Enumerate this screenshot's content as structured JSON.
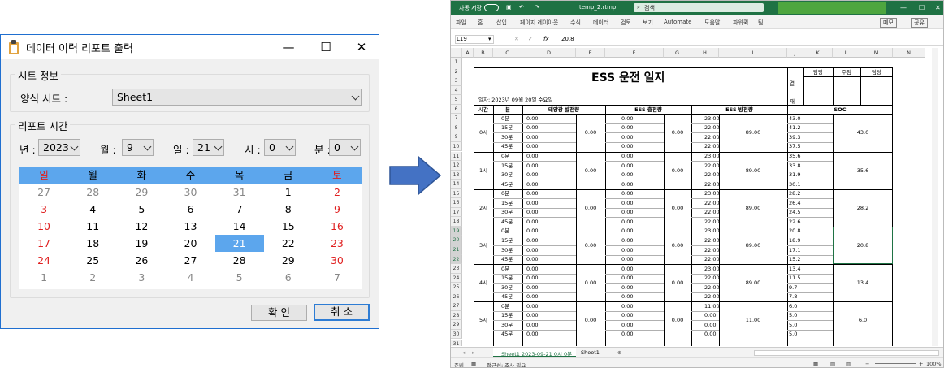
{
  "dialog": {
    "title": "데이터 이력 리포트 출력",
    "controls": {
      "minimize": "—",
      "maximize": "☐",
      "close": "✕"
    },
    "sheet_group": {
      "legend": "시트 정보",
      "label": "양식 시트 :",
      "value": "Sheet1"
    },
    "time_group": {
      "legend": "리포트 시간",
      "year_label": "년 :",
      "year": "2023",
      "month_label": "월 :",
      "month": "9",
      "day_label": "일 :",
      "day": "21",
      "hour_label": "시 :",
      "hour": "0",
      "minute_label": "분 :",
      "minute": "0"
    },
    "calendar": {
      "weekdays": [
        "일",
        "월",
        "화",
        "수",
        "목",
        "금",
        "토"
      ],
      "weeks": [
        [
          "27",
          "28",
          "29",
          "30",
          "31",
          "1",
          "2"
        ],
        [
          "3",
          "4",
          "5",
          "6",
          "7",
          "8",
          "9"
        ],
        [
          "10",
          "11",
          "12",
          "13",
          "14",
          "15",
          "16"
        ],
        [
          "17",
          "18",
          "19",
          "20",
          "21",
          "22",
          "23"
        ],
        [
          "24",
          "25",
          "26",
          "27",
          "28",
          "29",
          "30"
        ],
        [
          "1",
          "2",
          "3",
          "4",
          "5",
          "6",
          "7"
        ]
      ]
    },
    "ok": "확 인",
    "cancel": "취 소"
  },
  "excel": {
    "autosave": "자동 저장",
    "filename": "temp_2.rtmp",
    "search": "검색",
    "tabs": [
      "파일",
      "홈",
      "삽입",
      "페이지 레이아웃",
      "수식",
      "데이터",
      "검토",
      "보기",
      "Automate",
      "도움말",
      "파워퀵",
      "팀"
    ],
    "memo": "메모",
    "share": "공유",
    "namebox": "L19",
    "fx": "fx",
    "formula": "20.8",
    "columns": [
      "A",
      "B",
      "C",
      "D",
      "E",
      "F",
      "G",
      "H",
      "I",
      "J",
      "K",
      "L",
      "M",
      "N"
    ],
    "rows": [
      "1",
      "2",
      "3",
      "4",
      "5",
      "6",
      "7",
      "8",
      "9",
      "10",
      "11",
      "12",
      "13",
      "14",
      "15",
      "16",
      "17",
      "18",
      "19",
      "20",
      "21",
      "22",
      "23",
      "24",
      "25",
      "26",
      "27",
      "28",
      "29",
      "30",
      "31"
    ],
    "sheet": {
      "title": "ESS 운전 일지",
      "date": "일자: 2023년 09월 20일 수요일",
      "approval": "결 재",
      "approvers": [
        "담당",
        "주임",
        "담당"
      ],
      "headers": [
        "시간",
        "분",
        "태양광 발전량",
        "ESS 충전량",
        "ESS 방전량",
        "SOC"
      ],
      "hours": [
        {
          "label": "0시",
          "minutes": [
            "0분",
            "15분",
            "30분",
            "45분"
          ],
          "solar": [
            "0.00",
            "0.00",
            "0.00",
            "0.00"
          ],
          "solar_sum": "0.00",
          "charge": [
            "0.00",
            "0.00",
            "0.00",
            "0.00"
          ],
          "charge_sum": "0.00",
          "discharge": [
            "23.00",
            "22.00",
            "22.00",
            "22.00"
          ],
          "discharge_sum": "89.00",
          "soc": [
            "43.0",
            "41.2",
            "39.3",
            "37.5"
          ],
          "soc_val": "43.0"
        },
        {
          "label": "1시",
          "minutes": [
            "0분",
            "15분",
            "30분",
            "45분"
          ],
          "solar": [
            "0.00",
            "0.00",
            "0.00",
            "0.00"
          ],
          "solar_sum": "0.00",
          "charge": [
            "0.00",
            "0.00",
            "0.00",
            "0.00"
          ],
          "charge_sum": "0.00",
          "discharge": [
            "23.00",
            "22.00",
            "22.00",
            "22.00"
          ],
          "discharge_sum": "89.00",
          "soc": [
            "35.6",
            "33.8",
            "31.9",
            "30.1"
          ],
          "soc_val": "35.6"
        },
        {
          "label": "2시",
          "minutes": [
            "0분",
            "15분",
            "30분",
            "45분"
          ],
          "solar": [
            "0.00",
            "0.00",
            "0.00",
            "0.00"
          ],
          "solar_sum": "0.00",
          "charge": [
            "0.00",
            "0.00",
            "0.00",
            "0.00"
          ],
          "charge_sum": "0.00",
          "discharge": [
            "23.00",
            "22.00",
            "22.00",
            "22.00"
          ],
          "discharge_sum": "89.00",
          "soc": [
            "28.2",
            "26.4",
            "24.5",
            "22.6"
          ],
          "soc_val": "28.2"
        },
        {
          "label": "3시",
          "minutes": [
            "0분",
            "15분",
            "30분",
            "45분"
          ],
          "solar": [
            "0.00",
            "0.00",
            "0.00",
            "0.00"
          ],
          "solar_sum": "0.00",
          "charge": [
            "0.00",
            "0.00",
            "0.00",
            "0.00"
          ],
          "charge_sum": "0.00",
          "discharge": [
            "23.00",
            "22.00",
            "22.00",
            "22.00"
          ],
          "discharge_sum": "89.00",
          "soc": [
            "20.8",
            "18.9",
            "17.1",
            "15.2"
          ],
          "soc_val": "20.8"
        },
        {
          "label": "4시",
          "minutes": [
            "0분",
            "15분",
            "30분",
            "45분"
          ],
          "solar": [
            "0.00",
            "0.00",
            "0.00",
            "0.00"
          ],
          "solar_sum": "0.00",
          "charge": [
            "0.00",
            "0.00",
            "0.00",
            "0.00"
          ],
          "charge_sum": "0.00",
          "discharge": [
            "23.00",
            "22.00",
            "22.00",
            "22.00"
          ],
          "discharge_sum": "89.00",
          "soc": [
            "13.4",
            "11.5",
            "9.7",
            "7.8"
          ],
          "soc_val": "13.4"
        },
        {
          "label": "5시",
          "minutes": [
            "0분",
            "15분",
            "30분",
            "45분"
          ],
          "solar": [
            "0.00",
            "0.00",
            "0.00",
            "0.00"
          ],
          "solar_sum": "0.00",
          "charge": [
            "0.00",
            "0.00",
            "0.00",
            "0.00"
          ],
          "charge_sum": "0.00",
          "discharge": [
            "11.00",
            "0.00",
            "0.00",
            "0.00"
          ],
          "discharge_sum": "11.00",
          "soc": [
            "6.0",
            "5.0",
            "5.0",
            "5.0"
          ],
          "soc_val": "6.0"
        }
      ]
    },
    "sheet_tabs": [
      "Sheet1 2023-09-21 0시 0분",
      "Sheet1"
    ],
    "status": "준비",
    "accessibility": "접근성: 조사 필요",
    "zoom": "100%"
  }
}
